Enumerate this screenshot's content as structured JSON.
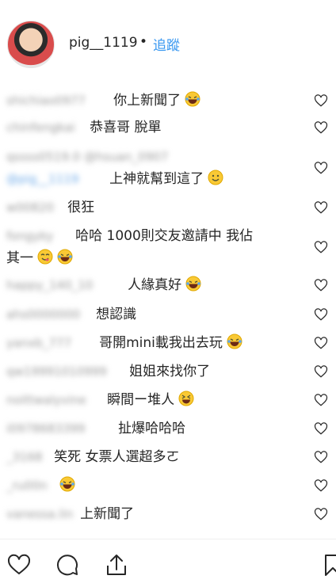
{
  "header": {
    "username": "pig__1119",
    "dot": "•",
    "follow_label": "追蹤"
  },
  "comments": [
    {
      "user": "shichiao0977",
      "text": "你上新聞了",
      "emoji": "laugh"
    },
    {
      "user": "chinfengkai",
      "text": "恭喜哥 脫單",
      "emoji": ""
    },
    {
      "user": "qssss0519.0 @hsuan_0907",
      "user2": "@pig__1119",
      "text": "上神就幫到這了",
      "emoji": "smile"
    },
    {
      "user": "w00820",
      "text": "很狂",
      "emoji": ""
    },
    {
      "user": "fongyky",
      "text": "哈哈 1000則交友邀請中 我佔",
      "text2": "其一",
      "emoji": "yum",
      "emoji2": "laugh"
    },
    {
      "user": "happy_140_10",
      "text": "人緣真好",
      "emoji": "laugh"
    },
    {
      "user": "ahs0000000",
      "text": "想認識",
      "emoji": ""
    },
    {
      "user": "yanxb_777",
      "text": "哥開mini載我出去玩",
      "emoji": "laugh"
    },
    {
      "user": "qw19991010999",
      "text": "姐姐來找你了",
      "emoji": ""
    },
    {
      "user": "noittwalyvine",
      "text": "瞬間ー堆人",
      "emoji": "squint"
    },
    {
      "user": "i0978683399",
      "text": "扯爆哈哈哈",
      "emoji": ""
    },
    {
      "user": "_3168",
      "text": "笑死 女票人選超多ㄛ",
      "emoji": ""
    },
    {
      "user": "_ru00n",
      "text": "",
      "emoji": "laugh"
    },
    {
      "user": "vanessa.lin",
      "text": "上新聞了",
      "emoji": ""
    }
  ],
  "actions": {
    "icons": [
      "heart-icon",
      "comment-icon",
      "share-icon",
      "bookmark-icon"
    ]
  }
}
